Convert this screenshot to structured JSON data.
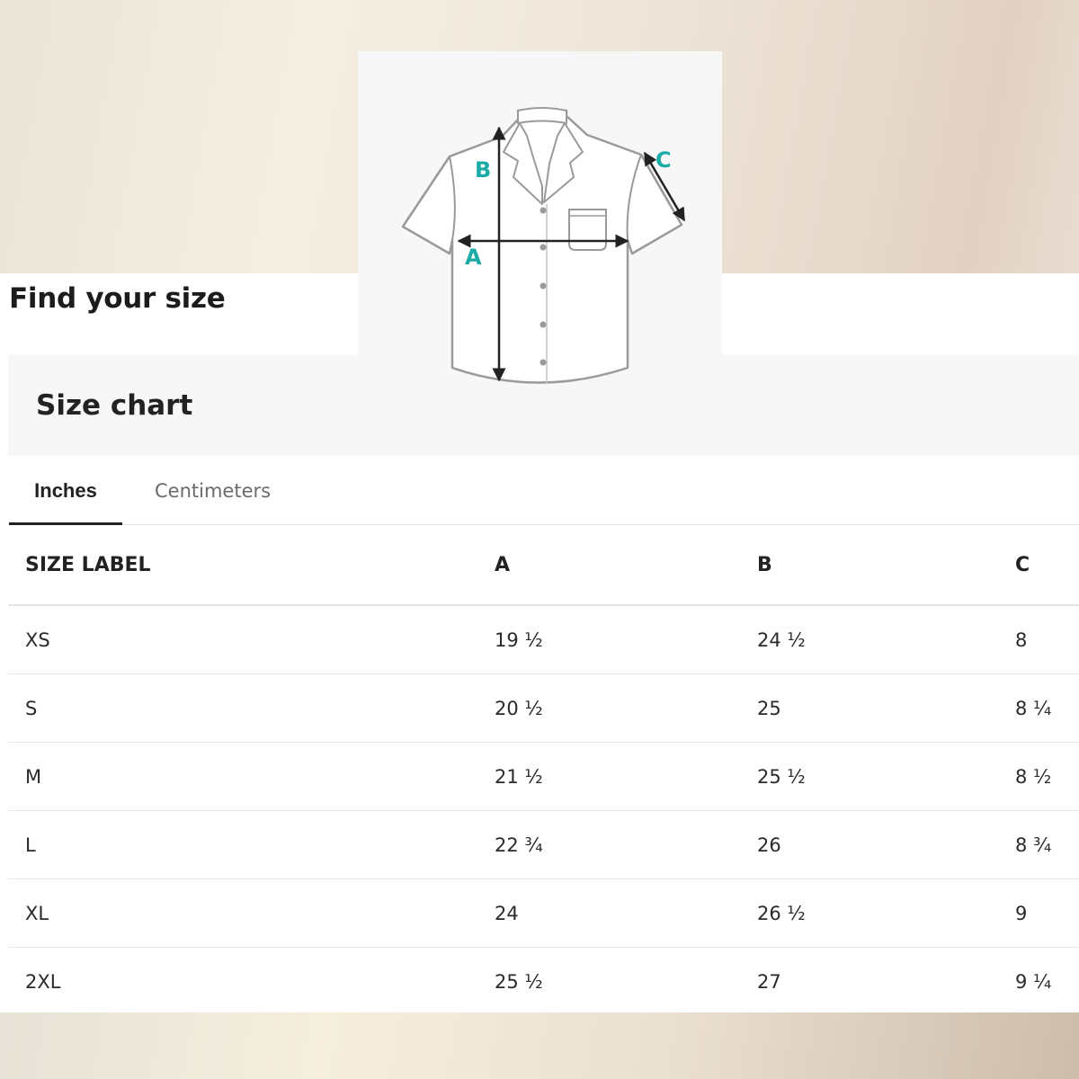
{
  "page": {
    "title": "Find your size"
  },
  "diagram": {
    "labels": [
      "A",
      "B",
      "C"
    ],
    "label_color": "#1aaba6"
  },
  "chart": {
    "title": "Size chart"
  },
  "tabs": [
    {
      "label": "Inches",
      "active": true
    },
    {
      "label": "Centimeters",
      "active": false
    }
  ],
  "table": {
    "headers": [
      "SIZE LABEL",
      "A",
      "B",
      "C"
    ],
    "rows": [
      [
        "XS",
        "19 ½",
        "24 ½",
        "8"
      ],
      [
        "S",
        "20 ½",
        "25",
        "8 ¼"
      ],
      [
        "M",
        "21 ½",
        "25 ½",
        "8 ½"
      ],
      [
        "L",
        "22 ¾",
        "26",
        "8 ¾"
      ],
      [
        "XL",
        "24",
        "26 ½",
        "9"
      ],
      [
        "2XL",
        "25 ½",
        "27",
        "9 ¼"
      ]
    ]
  }
}
